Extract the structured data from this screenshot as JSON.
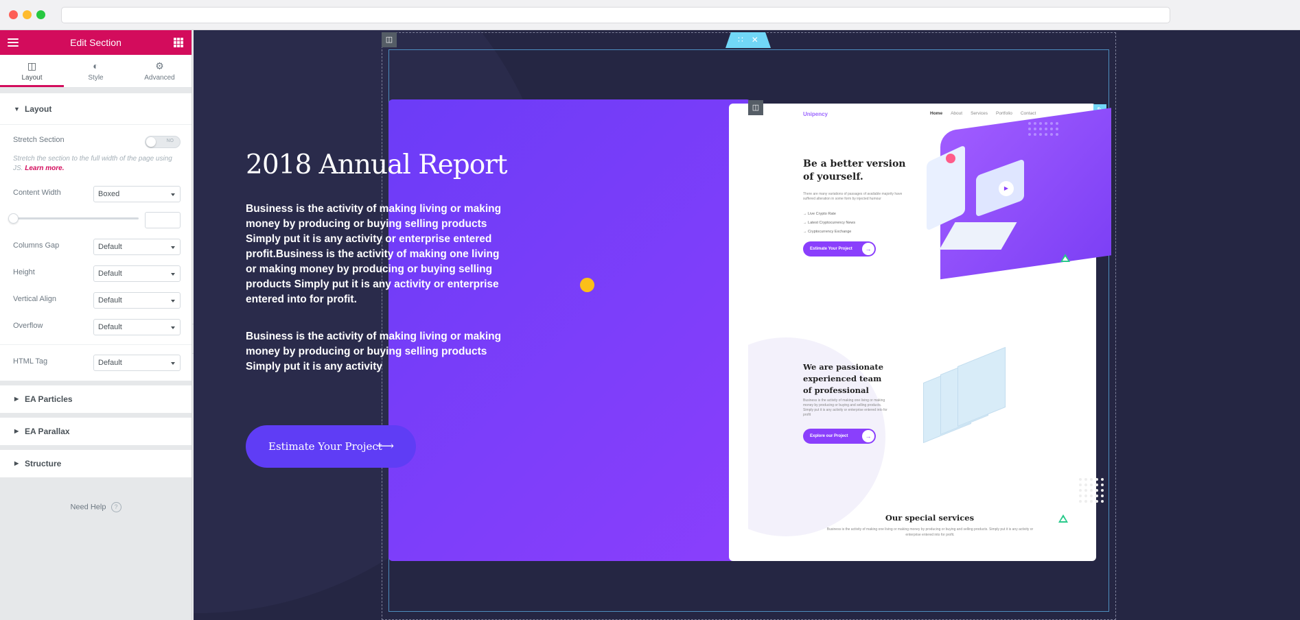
{
  "panel": {
    "title": "Edit Section",
    "tabs": [
      {
        "label": "Layout",
        "icon": "layout-icon"
      },
      {
        "label": "Style",
        "icon": "half-circle-icon"
      },
      {
        "label": "Advanced",
        "icon": "gear-icon"
      }
    ],
    "layout_section": {
      "title": "Layout",
      "stretch_label": "Stretch Section",
      "stretch_state": "NO",
      "stretch_desc": "Stretch the section to the full width of the page using JS.",
      "learn_more": "Learn more.",
      "content_width_label": "Content Width",
      "content_width_value": "Boxed",
      "columns_gap_label": "Columns Gap",
      "columns_gap_value": "Default",
      "height_label": "Height",
      "height_value": "Default",
      "vertical_align_label": "Vertical Align",
      "vertical_align_value": "Default",
      "overflow_label": "Overflow",
      "overflow_value": "Default",
      "html_tag_label": "HTML Tag",
      "html_tag_value": "Default"
    },
    "accordions": [
      "EA Particles",
      "EA Parallax",
      "Structure"
    ],
    "need_help": "Need Help",
    "help_icon": "?"
  },
  "canvas": {
    "report_title": "2018 Annual Report",
    "paragraph1": "Business is the activity of making living or making money by producing or buying selling products Simply put it is any activity or enterprise entered profit.Business is the activity of making one living or making money by producing or buying selling products Simply put it is any activity or enterprise entered into for profit.",
    "paragraph2": "Business is the activity of making living or making money by producing or buying selling products Simply put it is any activity",
    "cta_label": "Estimate Your Project",
    "cta_arrow": "⟶"
  },
  "preview": {
    "logo": "Unipency",
    "nav": [
      "Home",
      "About",
      "Services",
      "Portfolio",
      "Contact"
    ],
    "hero_title": "Be a better version of yourself.",
    "hero_text": "There are many variations of passages of available majority have suffered alteration in some form by injected humour",
    "hero_list": [
      "Live Crypto Rate",
      "Latest Cryptocurrency News",
      "Cryptocurrency Exchange"
    ],
    "hero_button": "Estimate Your Project",
    "team_title": "We are passionate experienced team of professional",
    "team_text": "Business is the activity of making one living or making money by producing or buying and selling products. Simply put it is any activity or enterprise entered into for profit",
    "team_button": "Explore our Project",
    "services_title": "Our special services",
    "services_text": "Business is the activity of making one living or making money by producing or buying and selling products. Simply put it is any activity or enterprise entered into for profit."
  },
  "colors": {
    "brand": "#d30c5c",
    "canvas_bg": "#252643",
    "card_purple": "#7a3ef9",
    "cta": "#5f3df5",
    "handle": "#71d7f7"
  }
}
